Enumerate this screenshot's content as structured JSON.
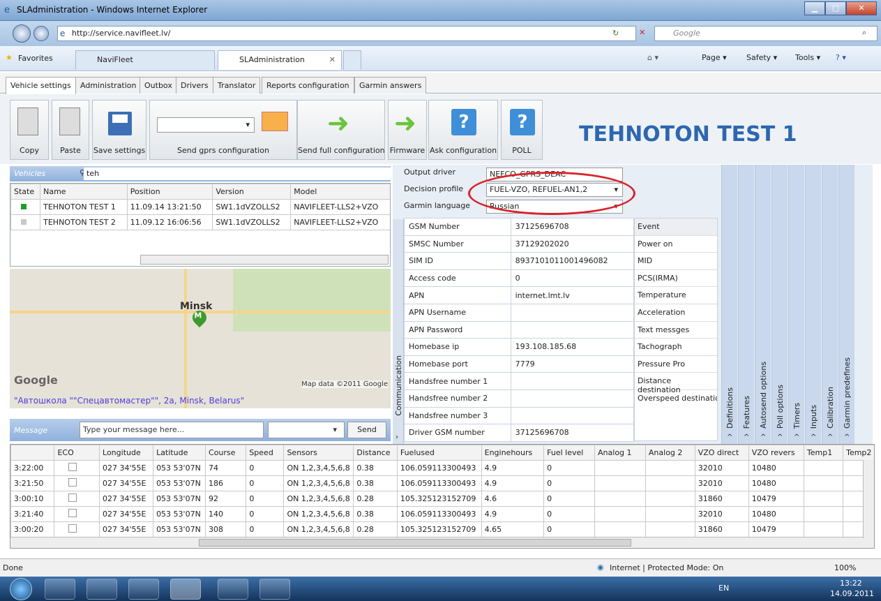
{
  "window": {
    "title": "SLAdministration - Windows Internet Explorer",
    "url": "http://service.navifleet.lv/",
    "search_placeholder": "Google"
  },
  "favbar": {
    "favorites": "Favorites",
    "tabs": [
      "NaviFleet",
      "SLAdministration"
    ],
    "commands": [
      "Page ▾",
      "Safety ▾",
      "Tools ▾"
    ]
  },
  "app_tabs": [
    "Vehicle settings",
    "Administration",
    "Outbox",
    "Drivers",
    "Translator",
    "Reports configuration",
    "Garmin answers"
  ],
  "toolbar": {
    "copy": "Copy",
    "paste": "Paste",
    "save": "Save settings",
    "send_gprs": "Send gprs configuration",
    "send_full": "Send full configuration",
    "firmware": "Firmware",
    "ask": "Ask configuration",
    "poll": "POLL"
  },
  "vehicle_title": "TEHNOTON TEST 1",
  "vehicles": {
    "header": "Vehicles",
    "search": "teh",
    "columns": [
      "State",
      "Name",
      "Position",
      "Version",
      "Model"
    ],
    "rows": [
      [
        "",
        "TEHNOTON TEST 1",
        "11.09.14 13:21:50",
        "SW1.1dVZOLLS2",
        "NAVIFLEET-LLS2+VZO"
      ],
      [
        "",
        "TEHNOTON TEST 2",
        "11.09.12 16:06:56",
        "SW1.1dVZOLLS2",
        "NAVIFLEET-LLS2+VZO"
      ]
    ],
    "state_colors": [
      "#1f9d2a",
      "#c8c8c8"
    ]
  },
  "map": {
    "city": "Minsk",
    "address": "\"Автошкола \"\"Спецавтомастер\"\", 2a, Minsk, Belarus\"",
    "credit": "Map data ©2011 Google",
    "logo": "Google"
  },
  "message": {
    "label": "Message",
    "placeholder": "Type your message here...",
    "send": "Send"
  },
  "config": {
    "output_driver_label": "Output driver",
    "output_driver": "NEFCO_GPRS_DEAC",
    "decision_label": "Decision profile",
    "decision": "FUEL-VZO, REFUEL-AN1,2",
    "garmin_label": "Garmin language",
    "garmin": "Russian"
  },
  "comm_tab": "Communication",
  "props": [
    [
      "GSM Number",
      "37125696708"
    ],
    [
      "SMSC Number",
      "37129202020"
    ],
    [
      "SIM ID",
      "8937101011001496082"
    ],
    [
      "Access code",
      "0"
    ],
    [
      "APN",
      "internet.lmt.lv"
    ],
    [
      "APN Username",
      ""
    ],
    [
      "APN Password",
      ""
    ],
    [
      "Homebase ip",
      "193.108.185.68"
    ],
    [
      "Homebase port",
      "7779"
    ],
    [
      "Handsfree number 1",
      ""
    ],
    [
      "Handsfree number 2",
      ""
    ],
    [
      "Handsfree number 3",
      ""
    ],
    [
      "Driver GSM number",
      "37125696708"
    ]
  ],
  "events": [
    "Event",
    "Power on",
    "MID",
    "PCS(IRMA)",
    "Temperature",
    "Acceleration",
    "Text messges",
    "Tachograph",
    "Pressure Pro",
    "Distance destination",
    "Overspeed destinatio"
  ],
  "vtabs": [
    "Definitions",
    "Features",
    "Autosend options",
    "Poll options",
    "Timers",
    "Inputs",
    "Calibration",
    "Garmin predefines"
  ],
  "log": {
    "columns": [
      "",
      "ECO",
      "Longitude",
      "Latitude",
      "Course",
      "Speed",
      "Sensors",
      "Distance",
      "Fuelused",
      "Enginehours",
      "Fuel level",
      "Analog 1",
      "Analog 2",
      "VZO direct",
      "VZO revers",
      "Temp1",
      "Temp2"
    ],
    "rows": [
      [
        "3:22:00",
        "",
        "027 34'55E",
        "053 53'07N",
        "74",
        "0",
        "ON 1,2,3,4,5,6,8",
        "0.38",
        "106.059113300493",
        "4.9",
        "0",
        "",
        "",
        "32010",
        "10480",
        "",
        ""
      ],
      [
        "3:21:50",
        "",
        "027 34'55E",
        "053 53'07N",
        "186",
        "0",
        "ON 1,2,3,4,5,6,8",
        "0.38",
        "106.059113300493",
        "4.9",
        "0",
        "",
        "",
        "32010",
        "10480",
        "",
        ""
      ],
      [
        "3:00:10",
        "",
        "027 34'55E",
        "053 53'07N",
        "92",
        "0",
        "ON 1,2,3,4,5,6,8",
        "0.28",
        "105.325123152709",
        "4.6",
        "0",
        "",
        "",
        "31860",
        "10479",
        "",
        ""
      ],
      [
        "3:21:40",
        "",
        "027 34'55E",
        "053 53'07N",
        "140",
        "0",
        "ON 1,2,3,4,5,6,8",
        "0.38",
        "106.059113300493",
        "4.9",
        "0",
        "",
        "",
        "32010",
        "10480",
        "",
        ""
      ],
      [
        "3:00:20",
        "",
        "027 34'55E",
        "053 53'07N",
        "308",
        "0",
        "ON 1,2,3,4,5,6,8",
        "0.28",
        "105.325123152709",
        "4.65",
        "0",
        "",
        "",
        "31860",
        "10479",
        "",
        ""
      ]
    ]
  },
  "status": {
    "left": "Done",
    "zone": "Internet | Protected Mode: On",
    "zoom": "100%"
  },
  "taskbar": {
    "lang": "EN",
    "time": "13:22",
    "date": "14.09.2011"
  }
}
